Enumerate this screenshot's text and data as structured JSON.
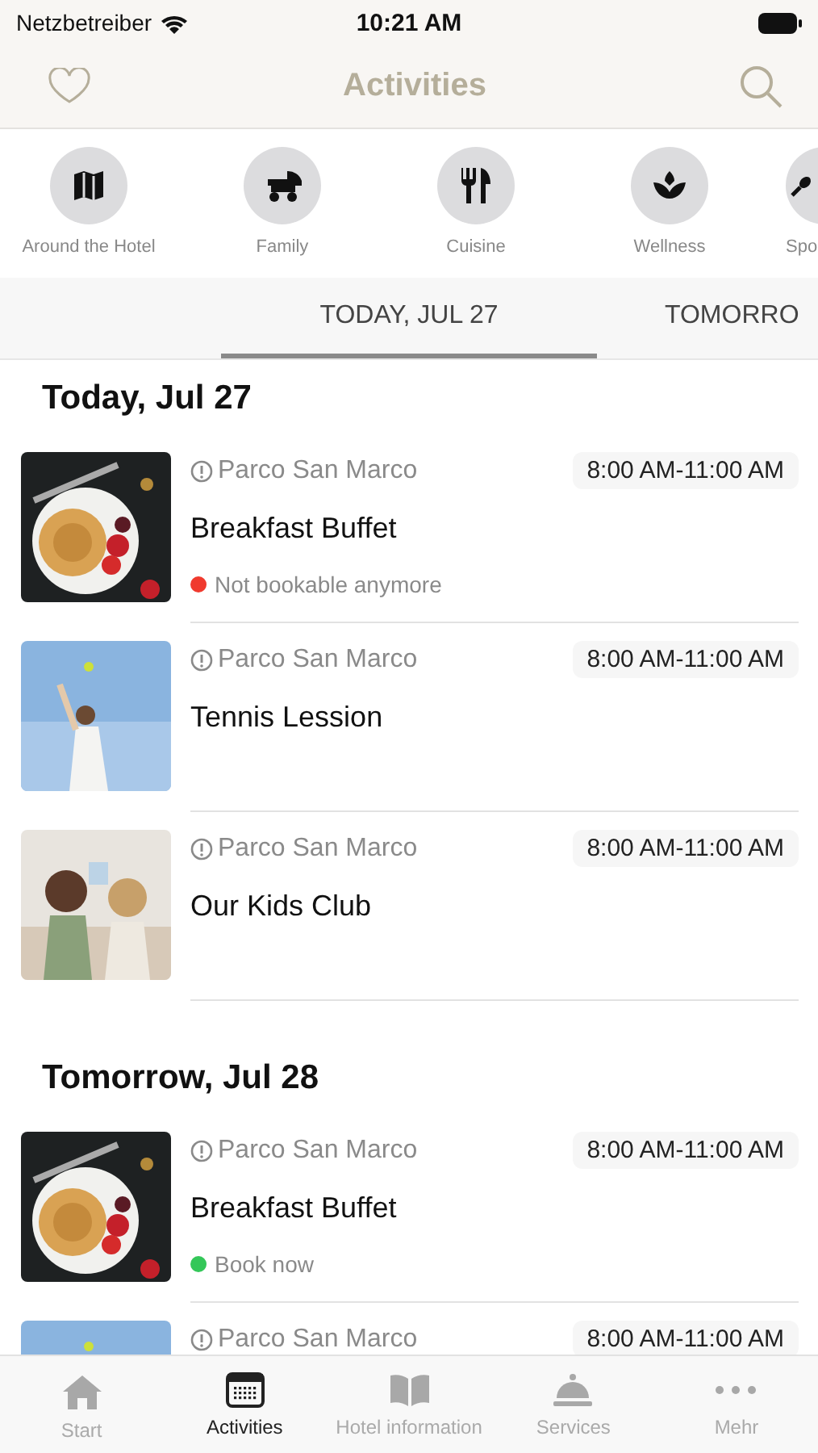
{
  "status_bar": {
    "carrier": "Netzbetreiber",
    "time": "10:21 AM"
  },
  "nav": {
    "title": "Activities"
  },
  "categories": [
    {
      "label": "Around the Hotel"
    },
    {
      "label": "Family"
    },
    {
      "label": "Cuisine"
    },
    {
      "label": "Wellness"
    },
    {
      "label": "Spo"
    }
  ],
  "date_tabs": [
    {
      "label": "TODAY, JUL 27",
      "selected": true
    },
    {
      "label": "TOMORRO",
      "selected": false
    }
  ],
  "sections": [
    {
      "title": "Today, Jul 27",
      "items": [
        {
          "location": "Parco San Marco",
          "time": "8:00 AM-11:00 AM",
          "title": "Breakfast Buffet",
          "status": {
            "text": "Not bookable anymore",
            "color": "#f03a2e"
          }
        },
        {
          "location": "Parco San Marco",
          "time": "8:00 AM-11:00 AM",
          "title": "Tennis Lession"
        },
        {
          "location": "Parco San Marco",
          "time": "8:00 AM-11:00 AM",
          "title": "Our Kids Club"
        }
      ]
    },
    {
      "title": "Tomorrow, Jul 28",
      "items": [
        {
          "location": "Parco San Marco",
          "time": "8:00 AM-11:00 AM",
          "title": "Breakfast Buffet",
          "status": {
            "text": "Book now",
            "color": "#34c759"
          }
        },
        {
          "location": "Parco San Marco",
          "time": "8:00 AM-11:00 AM"
        }
      ]
    }
  ],
  "tab_bar": [
    {
      "label": "Start",
      "selected": false
    },
    {
      "label": "Activities",
      "selected": true
    },
    {
      "label": "Hotel information",
      "selected": false
    },
    {
      "label": "Services",
      "selected": false
    },
    {
      "label": "Mehr",
      "selected": false
    }
  ]
}
